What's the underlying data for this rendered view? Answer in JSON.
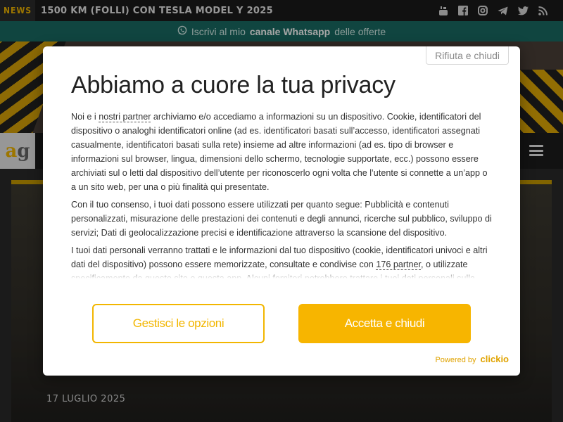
{
  "ticker": {
    "tag": "NEWS",
    "headline": "1500 KM (FOLLI) CON TESLA MODEL Y 2025",
    "socials": [
      "youtube-icon",
      "facebook-icon",
      "instagram-icon",
      "telegram-icon",
      "twitter-icon",
      "rss-icon"
    ]
  },
  "whatsapp_bar": {
    "prefix": "Iscrivi al mio",
    "bold": "canale Whatsapp",
    "suffix": "delle offerte"
  },
  "header": {
    "logo_a": "a",
    "logo_g": "g"
  },
  "article": {
    "date": "17 LUGLIO 2025"
  },
  "consent": {
    "reject_label": "Rifiuta e chiudi",
    "title": "Abbiamo a cuore la tua privacy",
    "p1_a": "Noi e i ",
    "p1_link": "nostri partner",
    "p1_b": " archiviamo e/o accediamo a informazioni su un dispositivo. Cookie, identificatori del dispositivo o analoghi identificatori online (ad es. identificatori basati sull’accesso, identificatori assegnati casualmente, identificatori basati sulla rete) insieme ad altre informazioni (ad es. tipo di browser e informazioni sul browser, lingua, dimensioni dello schermo, tecnologie supportate, ecc.) possono essere archiviati sul o letti dal dispositivo dell’utente per riconoscerlo ogni volta che l’utente si connette a un’app o a un sito web, per una o più finalità qui presentate.",
    "p2": "Con il tuo consenso, i tuoi dati possono essere utilizzati per quanto segue: Pubblicità e contenuti personalizzati, misurazione delle prestazioni dei contenuti e degli annunci, ricerche sul pubblico, sviluppo di servizi; Dati di geolocalizzazione precisi e identificazione attraverso la scansione del dispositivo.",
    "p3_a": "I tuoi dati personali verranno trattati e le informazioni dal tuo dispositivo (cookie, identificatori univoci e altri dati del dispositivo) possono essere memorizzate, consultate e condivise con ",
    "p3_link": "176 partner",
    "p3_b": ", o utilizzate specificamente da questo sito o questa app. Alcuni fornitori potrebbero trattare i tuoi dati personali sulla",
    "manage_label": "Gestisci le opzioni",
    "accept_label": "Accetta e chiudi",
    "powered_label": "Powered by",
    "powered_brand": "clickio"
  },
  "colors": {
    "accent": "#f7b500",
    "whatsapp_bar": "#1a6b63",
    "ticker_bg": "#1b1b1b"
  }
}
